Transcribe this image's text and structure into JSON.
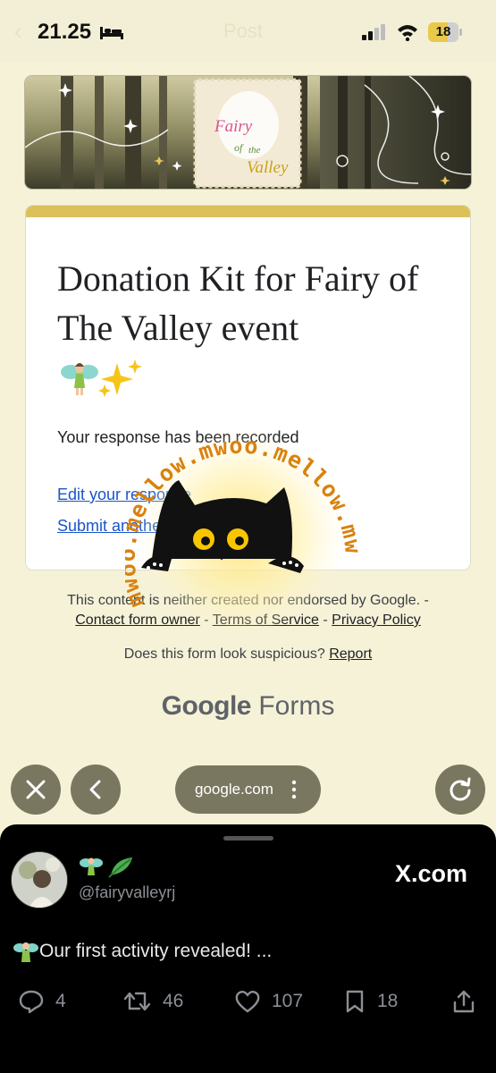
{
  "status_bar": {
    "time": "21.25",
    "faded_title": "Post",
    "battery": "18"
  },
  "form": {
    "title": "Donation Kit for Fairy of The Valley event",
    "title_emoji": "🧚✨",
    "response_message": "Your response has been recorded",
    "edit_link": "Edit your response",
    "submit_link": "Submit another response",
    "banner_text": [
      "Fairy",
      "of",
      "the",
      "Valley"
    ]
  },
  "footer": {
    "disclaimer": "This content is neither created nor endorsed by Google. -",
    "contact": "Contact form owner",
    "terms": "Terms of Service",
    "privacy": "Privacy Policy",
    "sep": " - ",
    "suspicious": "Does this form look suspicious?",
    "report": "Report",
    "brand_google": "Google",
    "brand_forms": "Forms"
  },
  "browser": {
    "url": "google.com"
  },
  "watermark": {
    "text": "mwoo.mellow.mwoo.mellow.mw"
  },
  "tweet": {
    "display_emoji": "🧚🌿",
    "handle": "@fairyvalleyrj",
    "source": "X.com",
    "text": "Our first activity revealed! ...",
    "text_emoji": "🧚",
    "replies": "4",
    "retweets": "46",
    "likes": "107",
    "bookmarks": "18"
  },
  "colors": {
    "page_bg": "#f6f2d8",
    "card_accent": "#dcc15a",
    "link": "#1a55c8",
    "watermark_orange": "#d9820f",
    "control_bg": "#7a7760"
  }
}
